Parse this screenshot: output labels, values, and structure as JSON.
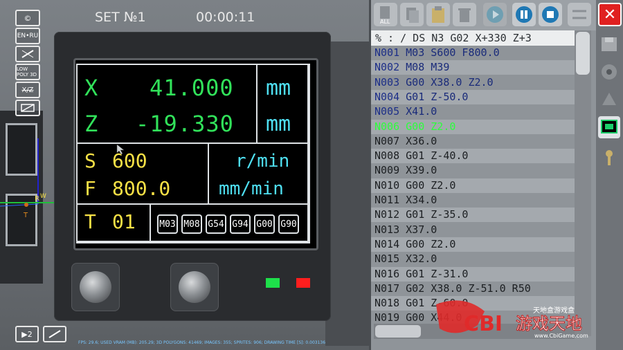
{
  "top_bar": {
    "set_label": "SET №1",
    "timer": "00:00:11"
  },
  "left_tools": [
    {
      "label": "©",
      "icon": "copyright-icon"
    },
    {
      "label": "EN•RU",
      "icon": "language-icon"
    },
    {
      "label": "",
      "icon": "pen-off-icon"
    },
    {
      "label": "LOW POLY 3D",
      "icon": "low-poly-icon"
    },
    {
      "label": "X/Z",
      "icon": "xz-axis-icon"
    },
    {
      "label": "",
      "icon": "view-toggle-icon"
    }
  ],
  "display": {
    "x_label": "X",
    "x_value": "41.000",
    "x_unit": "mm",
    "z_label": "Z",
    "z_value": "-19.330",
    "z_unit": "mm",
    "s_label": "S",
    "s_value": "600",
    "s_unit": "r/min",
    "f_label": "F",
    "f_value": "800.0",
    "f_unit": "mm/min",
    "t_label": "T",
    "t_value": "01",
    "modal_codes": [
      "M03",
      "M08",
      "G54",
      "G94",
      "G00",
      "G90"
    ]
  },
  "colors": {
    "value_green": "#31e25a",
    "unit_cyan": "#4fe0f2",
    "yellow": "#f7e146",
    "active_line": "#2cff3c",
    "lamp_green": "#1ee04a",
    "lamp_red": "#ff1e1e",
    "close_red": "#e02020"
  },
  "program_header": "% : / DS N3 G02 X+330 Z+3",
  "program": [
    {
      "n": "N001",
      "cmd": "M03 S600 F800.0"
    },
    {
      "n": "N002",
      "cmd": "M08 M39"
    },
    {
      "n": "N003",
      "cmd": "G00 X38.0 Z2.0"
    },
    {
      "n": "N004",
      "cmd": "G01 Z-50.0"
    },
    {
      "n": "N005",
      "cmd": "X41.0"
    },
    {
      "n": "N006",
      "cmd": "G00 Z2.0"
    },
    {
      "n": "N007",
      "cmd": "X36.0"
    },
    {
      "n": "N008",
      "cmd": "G01 Z-40.0"
    },
    {
      "n": "N009",
      "cmd": "X39.0"
    },
    {
      "n": "N010",
      "cmd": "G00 Z2.0"
    },
    {
      "n": "N011",
      "cmd": "X34.0"
    },
    {
      "n": "N012",
      "cmd": "G01 Z-35.0"
    },
    {
      "n": "N013",
      "cmd": "X37.0"
    },
    {
      "n": "N014",
      "cmd": "G00 Z2.0"
    },
    {
      "n": "N015",
      "cmd": "X32.0"
    },
    {
      "n": "N016",
      "cmd": "G01 Z-31.0"
    },
    {
      "n": "N017",
      "cmd": "G02 X38.0 Z-51.0 R50"
    },
    {
      "n": "N018",
      "cmd": "G01 Z-60.0"
    },
    {
      "n": "N019",
      "cmd": "G00 X44.0"
    }
  ],
  "active_line": "N006",
  "toolbar_buttons": [
    {
      "name": "select-all-icon",
      "label": "ALL"
    },
    {
      "name": "copy-icon",
      "label": ""
    },
    {
      "name": "paste-icon",
      "label": ""
    },
    {
      "name": "trash-icon",
      "label": ""
    },
    {
      "name": "play-icon",
      "label": ""
    },
    {
      "name": "pause-icon",
      "label": ""
    },
    {
      "name": "stop-icon",
      "label": ""
    },
    {
      "name": "settings-sliders-icon",
      "label": ""
    },
    {
      "name": "close-icon",
      "label": "✕"
    }
  ],
  "axis_labels": {
    "z": "Z",
    "r": "R",
    "w": "W",
    "t": "T"
  },
  "bottom": {
    "camera_label": "▶2",
    "fps_text": "FPS: 29.6; USED VRAM (MB): 205.29; 3D POLYGONS: 41469; IMAGES: 355; SPRITES: 906; DRAWING TIME [S]: 0.003136"
  },
  "watermark": {
    "brand": "CBI",
    "cn_top": "天地盒游戏盒",
    "cn_main": "游戏天地",
    "url": "www.CbiGame.com"
  }
}
